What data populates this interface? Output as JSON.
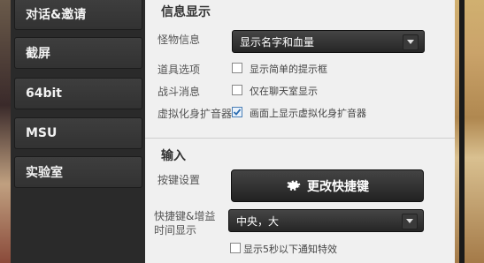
{
  "sidebar": {
    "items": [
      {
        "label": "对话&邀请"
      },
      {
        "label": "截屏"
      },
      {
        "label": "64bit"
      },
      {
        "label": "MSU"
      },
      {
        "label": "实验室"
      }
    ]
  },
  "info_display": {
    "title": "信息显示",
    "monster_info": {
      "label": "怪物信息",
      "selected": "显示名字和血量"
    },
    "item_option": {
      "label": "道具选项",
      "checkbox_label": "显示简单的提示框",
      "checked": false
    },
    "battle_message": {
      "label": "战斗消息",
      "checkbox_label": "仅在聊天室显示",
      "checked": false
    },
    "virtual_expander": {
      "label": "虚拟化身扩音器",
      "checkbox_label": "画面上显示虚拟化身扩音器",
      "checked": true
    }
  },
  "input": {
    "title": "输入",
    "key_settings": {
      "label": "按键设置",
      "button_label": "更改快捷键"
    },
    "hotkey_display": {
      "label_line1": "快捷键&增益",
      "label_line2": "时间显示",
      "selected": "中央，大"
    },
    "notify_effect": {
      "checkbox_label": "显示5秒以下通知特效",
      "checked": false
    }
  },
  "colors": {
    "panel_bg": "#2a2a2a",
    "content_bg": "#f0f0f0",
    "checkbox_accent": "#4a7fb6"
  },
  "icons": {
    "dropdown": "chevron-down-icon",
    "button": "gear-icon",
    "checked": "checkmark-icon"
  }
}
